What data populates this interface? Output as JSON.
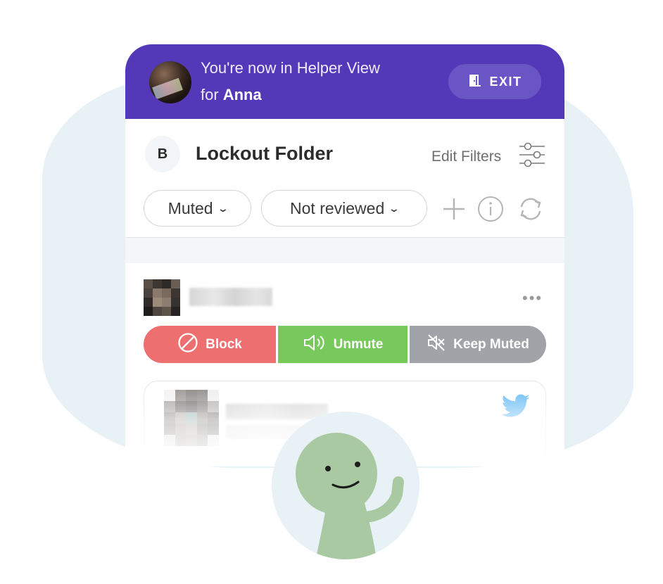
{
  "helper_view": {
    "line1": "You're now in Helper View",
    "line2_prefix": "for",
    "user_name": "Anna",
    "exit_label": "EXIT"
  },
  "folder": {
    "title": "Lockout Folder",
    "edit_filters_label": "Edit Filters",
    "logo_letter": "B"
  },
  "filters": {
    "muted_label": "Muted",
    "review_label": "Not reviewed"
  },
  "post": {
    "more_label": "•••"
  },
  "actions": {
    "block_label": "Block",
    "unmute_label": "Unmute",
    "keep_muted_label": "Keep Muted"
  },
  "colors": {
    "helper_bar": "#5339b8",
    "block": "#ee6f6f",
    "unmute": "#78c95c",
    "keep_muted": "#a1a3a9",
    "twitter": "#1d9bf0",
    "mascot": "#a9c9a2"
  },
  "icons": {
    "exit": "door-exit-icon",
    "filters": "sliders-icon",
    "add": "plus-icon",
    "info": "info-icon",
    "refresh": "refresh-icon",
    "block": "prohibit-icon",
    "unmute": "speaker-icon",
    "keep_muted": "speaker-muted-icon",
    "source": "twitter-bird-icon"
  }
}
